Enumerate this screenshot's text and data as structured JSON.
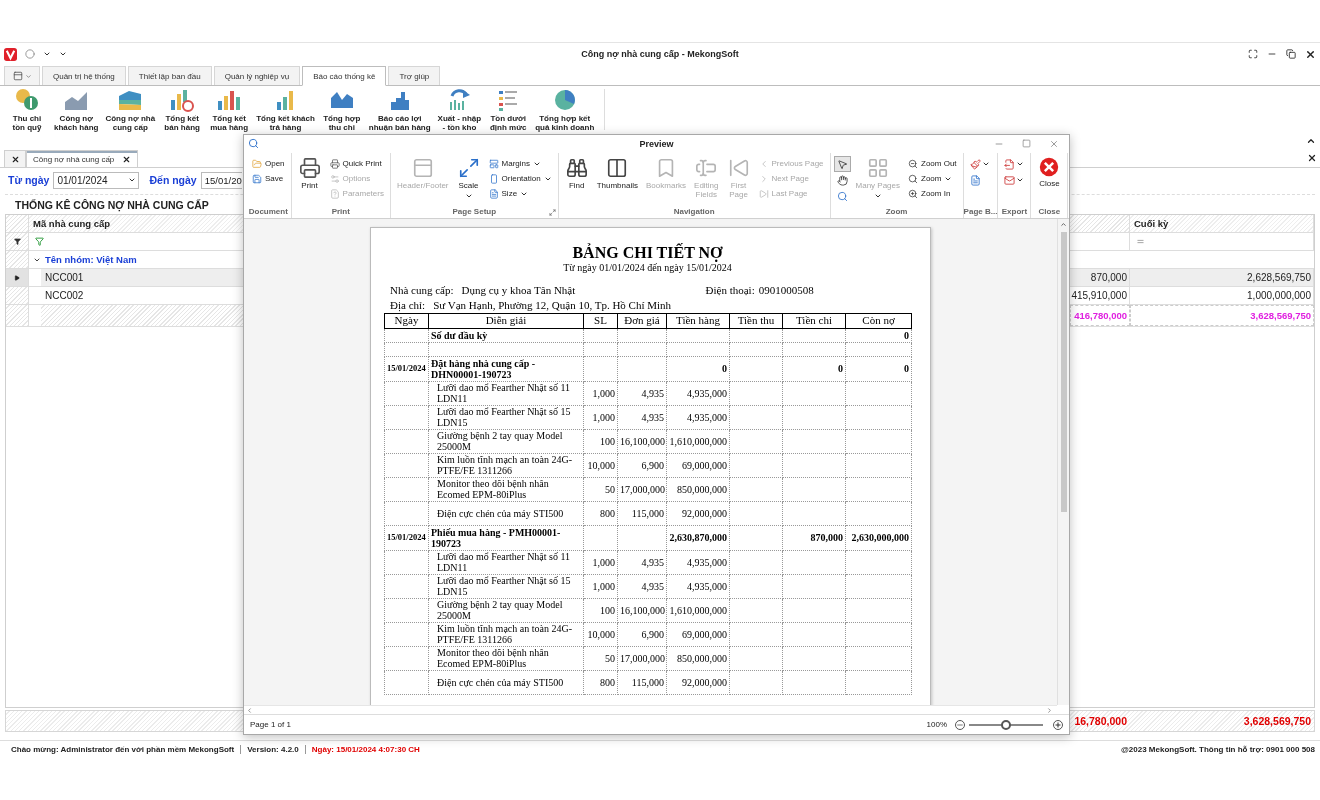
{
  "app": {
    "title": "Công nợ nhà cung cấp - MekongSoft"
  },
  "menu_tabs": [
    {
      "label": "Quản trị hệ thống",
      "selected": false
    },
    {
      "label": "Thiết lập ban đầu",
      "selected": false
    },
    {
      "label": "Quản lý nghiệp vụ",
      "selected": false
    },
    {
      "label": "Báo cáo thống kê",
      "selected": true
    },
    {
      "label": "Trợ giúp",
      "selected": false
    }
  ],
  "ribbon": [
    {
      "label": "Thu chi\ntồn quỹ"
    },
    {
      "label": "Công nợ\nkhách hàng"
    },
    {
      "label": "Công nợ nhà\ncung cấp"
    },
    {
      "label": "Tổng kết\nbán hàng"
    },
    {
      "label": "Tổng kết\nmua hàng"
    },
    {
      "label": "Tổng kết khách\ntrả hàng"
    },
    {
      "label": "Tổng hợp\nthu chi"
    },
    {
      "label": "Báo cáo lợi\nnhuận bán hàng"
    },
    {
      "label": "Xuất - nhập\n- tồn kho"
    },
    {
      "label": "Tồn dưới\nđịnh mức"
    },
    {
      "label": "Tổng hợp kết\nquả kinh doanh"
    }
  ],
  "doc_tabs": [
    {
      "label": "Công nợ nhà cung cấp",
      "selected": true
    }
  ],
  "filter": {
    "from_label": "Từ ngày",
    "from_value": "01/01/2024",
    "to_label": "Đến ngày",
    "to_value": "15/01/20"
  },
  "section_title": "THỐNG KÊ CÔNG NỢ NHÀ CUNG CẤP",
  "grid": {
    "header_code": "Mã nhà cung cấp",
    "header_end": "Cuối kỳ",
    "group": {
      "label": "Tên nhóm: Việt Nam",
      "expanded": true
    },
    "rows": [
      {
        "code": "NCC001",
        "column_2": "870,000",
        "end": "2,628,569,750",
        "selected": true
      },
      {
        "code": "NCC002",
        "column_2": "415,910,000",
        "end": "1,000,000,000",
        "selected": false
      }
    ],
    "totals": {
      "column_2": "416,780,000",
      "end": "3,628,569,750"
    }
  },
  "footer_totals": {
    "column_2": "16,780,000",
    "end": "3,628,569,750"
  },
  "preview": {
    "title": "Preview",
    "groups": [
      {
        "label": "Document",
        "launcher": false,
        "columns": [
          [
            {
              "kind": "small",
              "label": "Open",
              "disabled": false,
              "dropdown": false
            },
            {
              "kind": "small",
              "label": "Save",
              "disabled": false,
              "dropdown": false
            }
          ]
        ]
      },
      {
        "label": "Print",
        "launcher": false,
        "columns": [
          [
            {
              "kind": "large",
              "label": "Print",
              "disabled": false,
              "dropdown": false
            }
          ],
          [
            {
              "kind": "small",
              "label": "Quick Print",
              "disabled": false,
              "dropdown": false
            },
            {
              "kind": "small",
              "label": "Options",
              "disabled": true,
              "dropdown": false
            },
            {
              "kind": "small",
              "label": "Parameters",
              "disabled": true,
              "dropdown": false
            }
          ]
        ]
      },
      {
        "label": "Page Setup",
        "launcher": true,
        "columns": [
          [
            {
              "kind": "large",
              "label": "Header/Footer",
              "disabled": true,
              "dropdown": false
            }
          ],
          [
            {
              "kind": "large",
              "label": "Scale",
              "disabled": false,
              "dropdown": true
            }
          ],
          [
            {
              "kind": "small",
              "label": "Margins",
              "disabled": false,
              "dropdown": true
            },
            {
              "kind": "small",
              "label": "Orientation",
              "disabled": false,
              "dropdown": true
            },
            {
              "kind": "small",
              "label": "Size",
              "disabled": false,
              "dropdown": true
            }
          ]
        ]
      },
      {
        "label": "Navigation",
        "launcher": false,
        "columns": [
          [
            {
              "kind": "large",
              "label": "Find",
              "disabled": false,
              "dropdown": false
            }
          ],
          [
            {
              "kind": "large",
              "label": "Thumbnails",
              "disabled": false,
              "dropdown": false
            }
          ],
          [
            {
              "kind": "large",
              "label": "Bookmarks",
              "disabled": true,
              "dropdown": false
            }
          ],
          [
            {
              "kind": "large",
              "label": "Editing\nFields",
              "disabled": true,
              "dropdown": false
            }
          ],
          [
            {
              "kind": "large",
              "label": "First\nPage",
              "disabled": true,
              "dropdown": false
            }
          ],
          [
            {
              "kind": "small",
              "label": "Previous Page",
              "disabled": true,
              "dropdown": false
            },
            {
              "kind": "small",
              "label": "Next Page",
              "disabled": true,
              "dropdown": false
            },
            {
              "kind": "small",
              "label": "Last Page",
              "disabled": true,
              "dropdown": false
            }
          ]
        ]
      },
      {
        "label": "Zoom",
        "launcher": false,
        "columns": [
          [
            {
              "kind": "icon",
              "dropdown": false,
              "selected": true
            },
            {
              "kind": "icon",
              "dropdown": false,
              "selected": false
            },
            {
              "kind": "icon",
              "dropdown": false,
              "selected": false
            }
          ],
          [
            {
              "kind": "large",
              "label": "Many Pages",
              "disabled": true,
              "dropdown": true
            }
          ],
          [
            {
              "kind": "small",
              "label": "Zoom Out",
              "disabled": false,
              "dropdown": false
            },
            {
              "kind": "small",
              "label": "Zoom",
              "disabled": false,
              "dropdown": true
            },
            {
              "kind": "small",
              "label": "Zoom In",
              "disabled": false,
              "dropdown": false
            }
          ]
        ]
      },
      {
        "label": "Page B...",
        "launcher": false,
        "columns": [
          [
            {
              "kind": "icon",
              "dropdown": true,
              "selected": false
            },
            {
              "kind": "icon",
              "dropdown": false,
              "selected": false
            }
          ]
        ]
      },
      {
        "label": "Export",
        "launcher": false,
        "columns": [
          [
            {
              "kind": "icon",
              "dropdown": true,
              "selected": false
            },
            {
              "kind": "icon",
              "dropdown": true,
              "selected": false
            }
          ]
        ]
      },
      {
        "label": "Close",
        "launcher": false,
        "columns": [
          [
            {
              "kind": "large",
              "label": "Close",
              "disabled": false,
              "dropdown": false
            }
          ]
        ]
      }
    ],
    "report": {
      "title": "BẢNG CHI TIẾT NỢ",
      "subtitle": "Từ ngày 01/01/2024 đến ngày 15/01/2024",
      "supplier_label": "Nhà cung cấp:",
      "supplier": "Dụng cụ y khoa Tân Nhật",
      "phone_label": "Điện thoại:",
      "phone": "0901000508",
      "address_label": "Địa chỉ:",
      "address": "Sư Vạn Hạnh, Phường 12, Quận 10, Tp. Hồ Chí Minh",
      "columns": [
        "Ngày",
        "Diễn giải",
        "SL",
        "Đơn giá",
        "Tiền hàng",
        "Tiền thu",
        "Tiền chi",
        "Còn nợ"
      ],
      "rows": [
        {
          "kind": "balance",
          "description": "Số dư đầu kỳ",
          "balance": "0"
        },
        {
          "kind": "blank"
        },
        {
          "kind": "voucher",
          "date": "15/01/2024",
          "description": "Đặt hàng nhà cung cấp - DHN00001-190723",
          "amount": "0",
          "paid": "0",
          "balance": "0"
        },
        {
          "kind": "item",
          "description": "Lưỡi dao mổ Fearther Nhật số 11 LDN11",
          "qty": "1,000",
          "price": "4,935",
          "amount": "4,935,000"
        },
        {
          "kind": "item",
          "description": "Lưỡi dao mổ Fearther Nhật số 15 LDN15",
          "qty": "1,000",
          "price": "4,935",
          "amount": "4,935,000"
        },
        {
          "kind": "item",
          "description": "Giường bệnh 2 tay quay Model 25000M",
          "qty": "100",
          "price": "16,100,000",
          "amount": "1,610,000,000"
        },
        {
          "kind": "item",
          "description": "Kim luồn tĩnh mạch an toàn 24G-PTFE/FE 1311266",
          "qty": "10,000",
          "price": "6,900",
          "amount": "69,000,000"
        },
        {
          "kind": "item",
          "description": "Monitor theo dõi bệnh nhân Ecomed EPM-80iPlus",
          "qty": "50",
          "price": "17,000,000",
          "amount": "850,000,000"
        },
        {
          "kind": "item",
          "description": "Điện cực chén của máy STI500",
          "qty": "800",
          "price": "115,000",
          "amount": "92,000,000"
        },
        {
          "kind": "voucher",
          "date": "15/01/2024",
          "description": "Phiếu mua hàng - PMH00001-190723",
          "amount": "2,630,870,000",
          "paid": "870,000",
          "balance": "2,630,000,000"
        },
        {
          "kind": "item",
          "description": "Lưỡi dao mổ Fearther Nhật số 11 LDN11",
          "qty": "1,000",
          "price": "4,935",
          "amount": "4,935,000"
        },
        {
          "kind": "item",
          "description": "Lưỡi dao mổ Fearther Nhật số 15 LDN15",
          "qty": "1,000",
          "price": "4,935",
          "amount": "4,935,000"
        },
        {
          "kind": "item",
          "description": "Giường bệnh 2 tay quay Model 25000M",
          "qty": "100",
          "price": "16,100,000",
          "amount": "1,610,000,000"
        },
        {
          "kind": "item",
          "description": "Kim luồn tĩnh mạch an toàn 24G-PTFE/FE 1311266",
          "qty": "10,000",
          "price": "6,900",
          "amount": "69,000,000"
        },
        {
          "kind": "item",
          "description": "Monitor theo dõi bệnh nhân Ecomed EPM-80iPlus",
          "qty": "50",
          "price": "17,000,000",
          "amount": "850,000,000"
        },
        {
          "kind": "item",
          "description": "Điện cực chén của máy STI500",
          "qty": "800",
          "price": "115,000",
          "amount": "92,000,000"
        }
      ]
    },
    "page_status": "Page 1 of 1",
    "zoom_label": "100%",
    "zoom": {
      "level": 0.5
    }
  },
  "status_bar": {
    "welcome": "Chào mừng: Administrator đến với phần mềm MekongSoft",
    "version": "Version: 4.2.0",
    "date": "Ngày: 15/01/2024 4:07:30 CH",
    "copyright": "@2023 MekongSoft. Thông tin hỗ trợ: 0901 000 508"
  }
}
